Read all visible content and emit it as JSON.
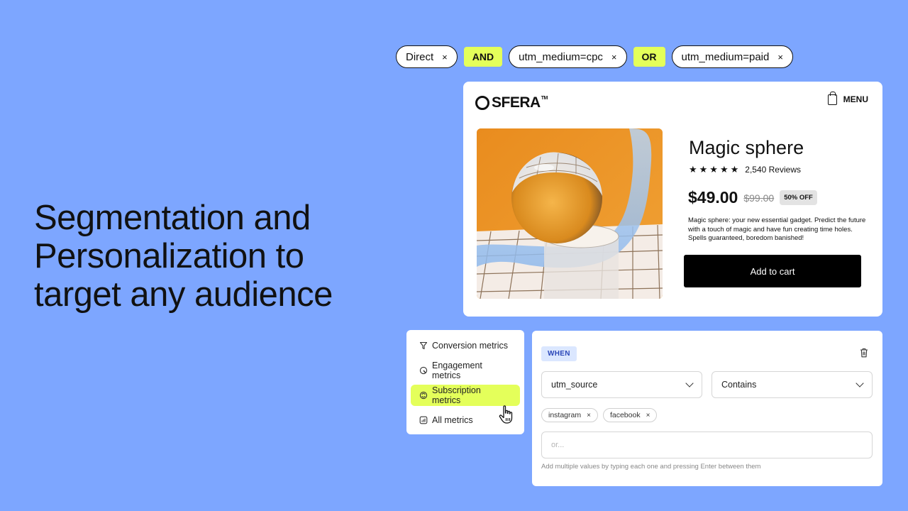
{
  "headline": {
    "lines": [
      "Segmentation and",
      "Personalization to",
      "target any audience"
    ]
  },
  "filters": {
    "chips": [
      {
        "label": "Direct",
        "remove_icon": "close-icon"
      },
      {
        "label": "utm_medium=cpc",
        "remove_icon": "close-icon"
      },
      {
        "label": "utm_medium=paid",
        "remove_icon": "close-icon"
      }
    ],
    "operators": [
      "AND",
      "OR"
    ],
    "close_glyph": "×",
    "operator_color": "#e4ff5a"
  },
  "product_card": {
    "brand": "SFERA",
    "trademark": "TM",
    "menu_label": "MENU",
    "menu_icon": "shopping-bag-icon",
    "title": "Magic sphere",
    "stars": "★★★★★",
    "rating": 5,
    "reviews": "2,540 Reviews",
    "price": "$49.00",
    "old_price": "$99.00",
    "discount": "50% OFF",
    "description": "Magic sphere: your new essential gadget. Predict the future with a touch of magic and have fun creating time holes. Spells guaranteed, boredom banished!",
    "cta": "Add to cart",
    "image_alt": "Crystal sphere on glass cylinder over tiled surface with blue ribbon, orange background"
  },
  "metrics_menu": {
    "items": [
      {
        "label": "Conversion metrics",
        "icon": "funnel-icon",
        "active": false
      },
      {
        "label": "Engagement metrics",
        "icon": "engagement-icon",
        "active": false
      },
      {
        "label": "Subscription metrics",
        "icon": "subscription-icon",
        "active": true
      },
      {
        "label": "All metrics",
        "icon": "chart-icon",
        "active": false
      }
    ],
    "highlight_color": "#e4ff5a"
  },
  "condition": {
    "badge": "WHEN",
    "delete_icon": "trash-icon",
    "field_select": "utm_source",
    "operator_select": "Contains",
    "values": [
      "instagram",
      "facebook"
    ],
    "input_placeholder": "or...",
    "input_value": "",
    "hint": "Add multiple values by typing each one and pressing Enter between them"
  },
  "colors": {
    "background": "#7da6ff",
    "accent": "#e4ff5a",
    "when_badge_bg": "#dbe7ff",
    "when_badge_text": "#2b47b8"
  }
}
